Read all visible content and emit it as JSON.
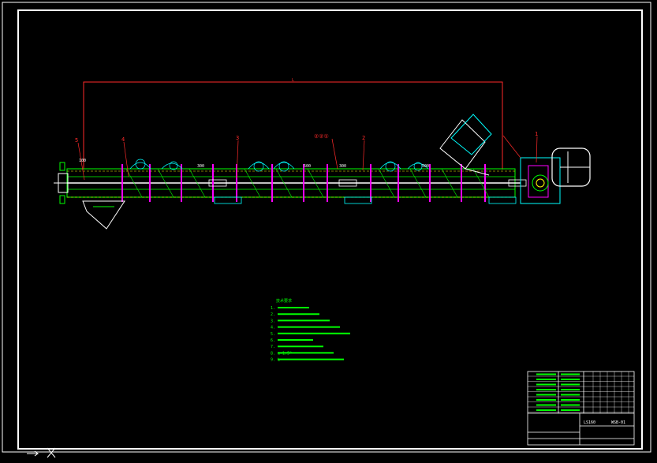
{
  "drawing": {
    "title": "",
    "part_labels": [
      "5",
      "4",
      "3",
      "②②①",
      "2",
      "1"
    ],
    "dimension_top": "L",
    "dim_labels": [
      "100",
      "300",
      "500",
      "300",
      "500"
    ],
    "tech_requirements": {
      "heading": "技术要求",
      "lines": [
        "1.",
        "2.",
        "3.",
        "4.",
        "5.",
        "6.",
        "7.",
        "8. α=1.5°",
        "9. L"
      ]
    },
    "title_block": {
      "name": "LS160",
      "code": "WSB-01",
      "drawing_no": ""
    }
  },
  "colors": {
    "frame": "#ffffff",
    "dim": "#ff2a2a",
    "body": "#00ff00",
    "screw": "#ff00ff",
    "detail": "#00ffff",
    "text": "#00ff00",
    "labels": "#ffff00"
  },
  "status": {
    "ucs_icon": "ucs-icon"
  }
}
